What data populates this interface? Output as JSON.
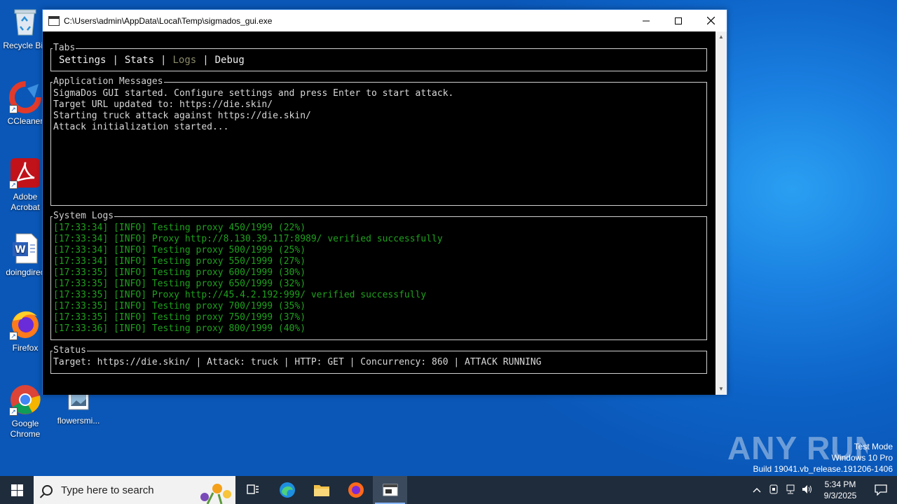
{
  "desktop": {
    "icons": [
      {
        "label": "Recycle Bin"
      },
      {
        "label": "CCleaner"
      },
      {
        "label": "Adobe Acrobat"
      },
      {
        "label": "doingdirec"
      },
      {
        "label": "Firefox"
      },
      {
        "label": "Google Chrome"
      },
      {
        "label": "flowersmi..."
      }
    ]
  },
  "window": {
    "title": "C:\\Users\\admin\\AppData\\Local\\Temp\\sigmados_gui.exe",
    "controls": {
      "minimize": "—",
      "maximize": "☐",
      "close": "✕"
    }
  },
  "console": {
    "tabs_legend": "Tabs",
    "tabs": [
      {
        "label": "Settings"
      },
      {
        "label": "Stats"
      },
      {
        "label": "Logs"
      },
      {
        "label": "Debug"
      }
    ],
    "separator": "|",
    "app_messages": {
      "legend": "Application Messages",
      "lines": [
        "SigmaDos GUI started. Configure settings and press Enter to start attack.",
        "Target URL updated to: https://die.skin/",
        "Starting truck attack against https://die.skin/",
        "Attack initialization started..."
      ]
    },
    "system_logs": {
      "legend": "System Logs",
      "lines": [
        "[17:33:34] [INFO] Testing proxy 450/1999 (22%)",
        "[17:33:34] [INFO] Proxy http://8.130.39.117:8989/ verified successfully",
        "[17:33:34] [INFO] Testing proxy 500/1999 (25%)",
        "[17:33:34] [INFO] Testing proxy 550/1999 (27%)",
        "[17:33:35] [INFO] Testing proxy 600/1999 (30%)",
        "[17:33:35] [INFO] Testing proxy 650/1999 (32%)",
        "[17:33:35] [INFO] Proxy http://45.4.2.192:999/ verified successfully",
        "[17:33:35] [INFO] Testing proxy 700/1999 (35%)",
        "[17:33:35] [INFO] Testing proxy 750/1999 (37%)",
        "[17:33:36] [INFO] Testing proxy 800/1999 (40%)"
      ]
    },
    "status": {
      "legend": "Status",
      "line": "Target: https://die.skin/ | Attack: truck | HTTP: GET | Concurrency: 860 | ATTACK RUNNING"
    }
  },
  "taskbar": {
    "search_placeholder": "Type here to search",
    "time": "5:34 PM",
    "date": "9/3/2025"
  },
  "watermark": {
    "brand": "ANY RUN",
    "line1": "Test Mode",
    "line2": "Windows 10 Pro",
    "line3": "Build 19041.vb_release.191206-1406"
  },
  "colors": {
    "log_green": "#1ea11e",
    "active_tab": "#8a8a6a",
    "taskbar": "#1f2c3c"
  }
}
